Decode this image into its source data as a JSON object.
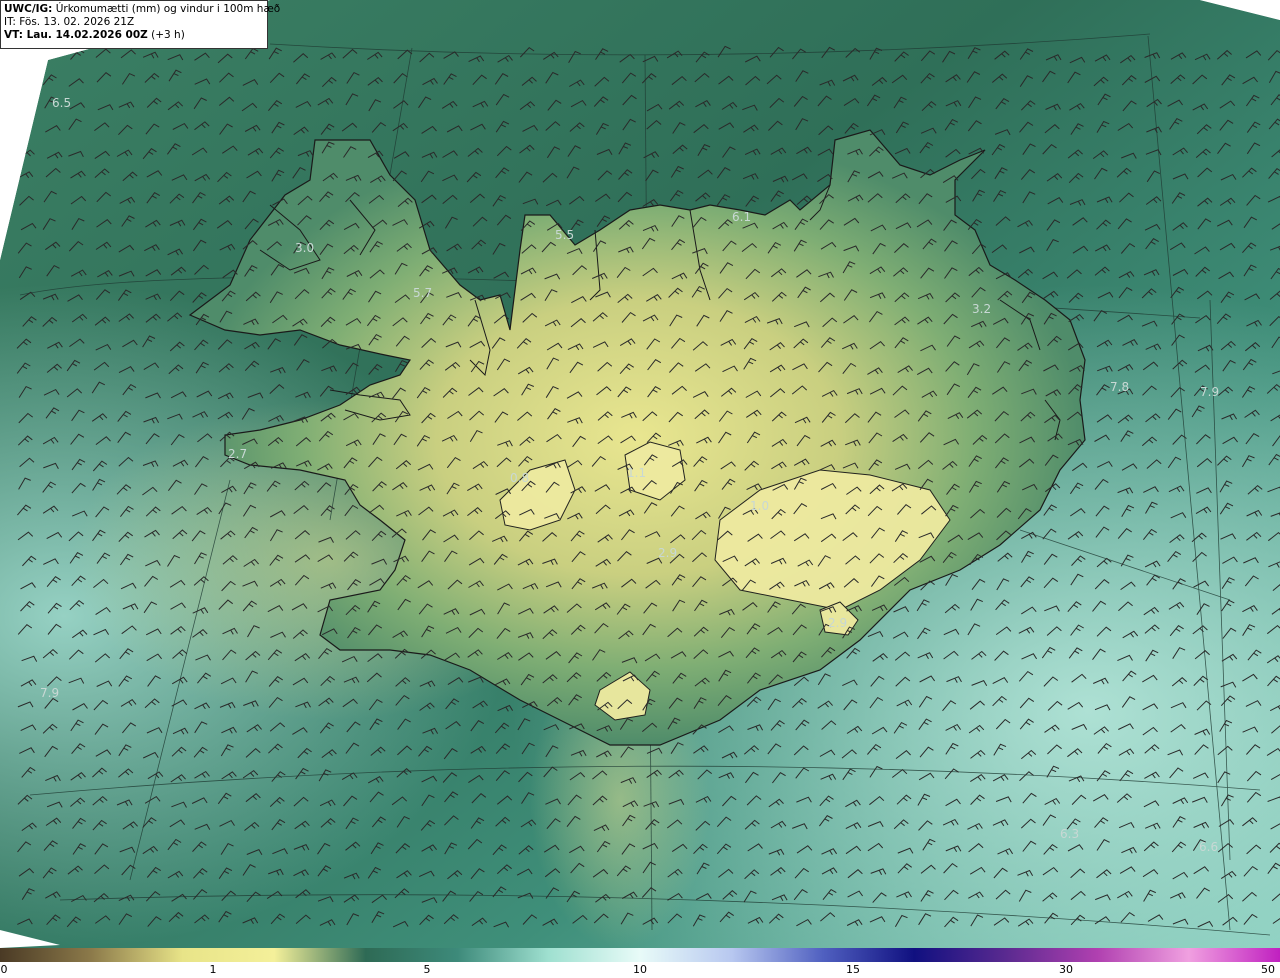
{
  "header": {
    "product": "UWC/IG:",
    "title": "Úrkomumætti (mm) og vindur i 100m hæð",
    "init_time": "IT: Fös. 13. 02. 2026 21Z",
    "valid_prefix": "VT: Lau. 14.02.2026 00Z",
    "valid_suffix": "(+3 h)"
  },
  "map_values": [
    "6.5",
    "3.0",
    "5.7",
    "5.5",
    "6.1",
    "3.2",
    "7.8",
    "7.9",
    "2.7",
    "0.8",
    "1.1",
    "1.0",
    "2.9",
    "2.9",
    "7.9",
    "6.3",
    "6.6"
  ],
  "colorbar": {
    "ticks": [
      "0",
      "1",
      "5",
      "10",
      "15",
      "30",
      "50"
    ],
    "colors": [
      "#4a3a25",
      "#8c7a4a",
      "#e8e488",
      "#f4f09a",
      "#2e6a55",
      "#3d8a7a",
      "#9fe0d0",
      "#e8fbf8",
      "#b8c8f0",
      "#5060c0",
      "#101080",
      "#5a2a90",
      "#b040b0",
      "#f0a0e0",
      "#c020c0"
    ]
  },
  "colors": {
    "land": "#d9d98a",
    "sea_dark": "#2f6e5a",
    "sea_light": "#8fd3c6",
    "coast": "#1a1a1a"
  }
}
